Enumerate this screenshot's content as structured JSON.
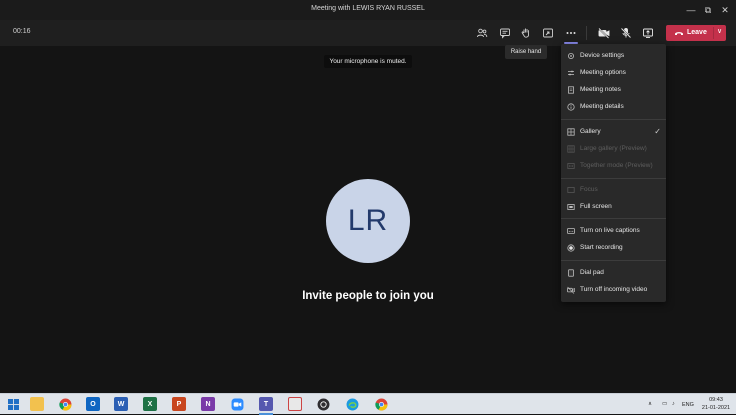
{
  "window": {
    "title": "Meeting with LEWIS RYAN RUSSEL",
    "minimize_glyph": "—",
    "restore_glyph": "⧉",
    "close_glyph": "✕"
  },
  "toolbar": {
    "timer": "00:16",
    "icons": [
      "participants-icon",
      "chat-icon",
      "raise-hand-icon",
      "share-tray-icon",
      "more-actions-icon",
      "camera-off-icon",
      "mic-off-icon",
      "share-screen-icon"
    ],
    "leave_label": "Leave",
    "leave_chevron": "∨",
    "accent_color": "#c4314b"
  },
  "tooltip": {
    "text": "Raise hand"
  },
  "banner": {
    "text": "Your microphone is muted."
  },
  "stage": {
    "avatar_initials": "LR",
    "invite_text": "Invite people to join you"
  },
  "menu": {
    "items": [
      {
        "label": "Device settings",
        "icon": "gear-icon",
        "enabled": true,
        "checked": false
      },
      {
        "label": "Meeting options",
        "icon": "sliders-icon",
        "enabled": true,
        "checked": false
      },
      {
        "label": "Meeting notes",
        "icon": "notes-icon",
        "enabled": true,
        "checked": false
      },
      {
        "label": "Meeting details",
        "icon": "info-icon",
        "enabled": true,
        "checked": false
      },
      {
        "label": "Gallery",
        "icon": "gallery-icon",
        "enabled": true,
        "checked": true
      },
      {
        "label": "Large gallery (Preview)",
        "icon": "large-gallery-icon",
        "enabled": false,
        "checked": false
      },
      {
        "label": "Together mode (Preview)",
        "icon": "together-mode-icon",
        "enabled": false,
        "checked": false
      },
      {
        "label": "Focus",
        "icon": "focus-icon",
        "enabled": false,
        "checked": false
      },
      {
        "label": "Full screen",
        "icon": "fullscreen-icon",
        "enabled": true,
        "checked": false
      },
      {
        "label": "Turn on live captions",
        "icon": "captions-icon",
        "enabled": true,
        "checked": false
      },
      {
        "label": "Start recording",
        "icon": "record-icon",
        "enabled": true,
        "checked": false
      },
      {
        "label": "Dial pad",
        "icon": "dialpad-icon",
        "enabled": true,
        "checked": false
      },
      {
        "label": "Turn off incoming video",
        "icon": "video-off-icon",
        "enabled": true,
        "checked": false
      }
    ],
    "check_glyph": "✓"
  },
  "taskbar": {
    "apps": [
      "windows-start",
      "file-explorer",
      "chrome",
      "outlook",
      "word",
      "excel",
      "powerpoint",
      "onenote",
      "zoom",
      "teams",
      "snip",
      "obs",
      "edge",
      "chrome-2"
    ],
    "app_letters": {
      "outlook": "O",
      "word": "W",
      "excel": "X",
      "powerpoint": "P",
      "onenote": "N",
      "teams": "T"
    },
    "lang": "ENG",
    "time": "09:43",
    "date": "21-01-2021"
  }
}
